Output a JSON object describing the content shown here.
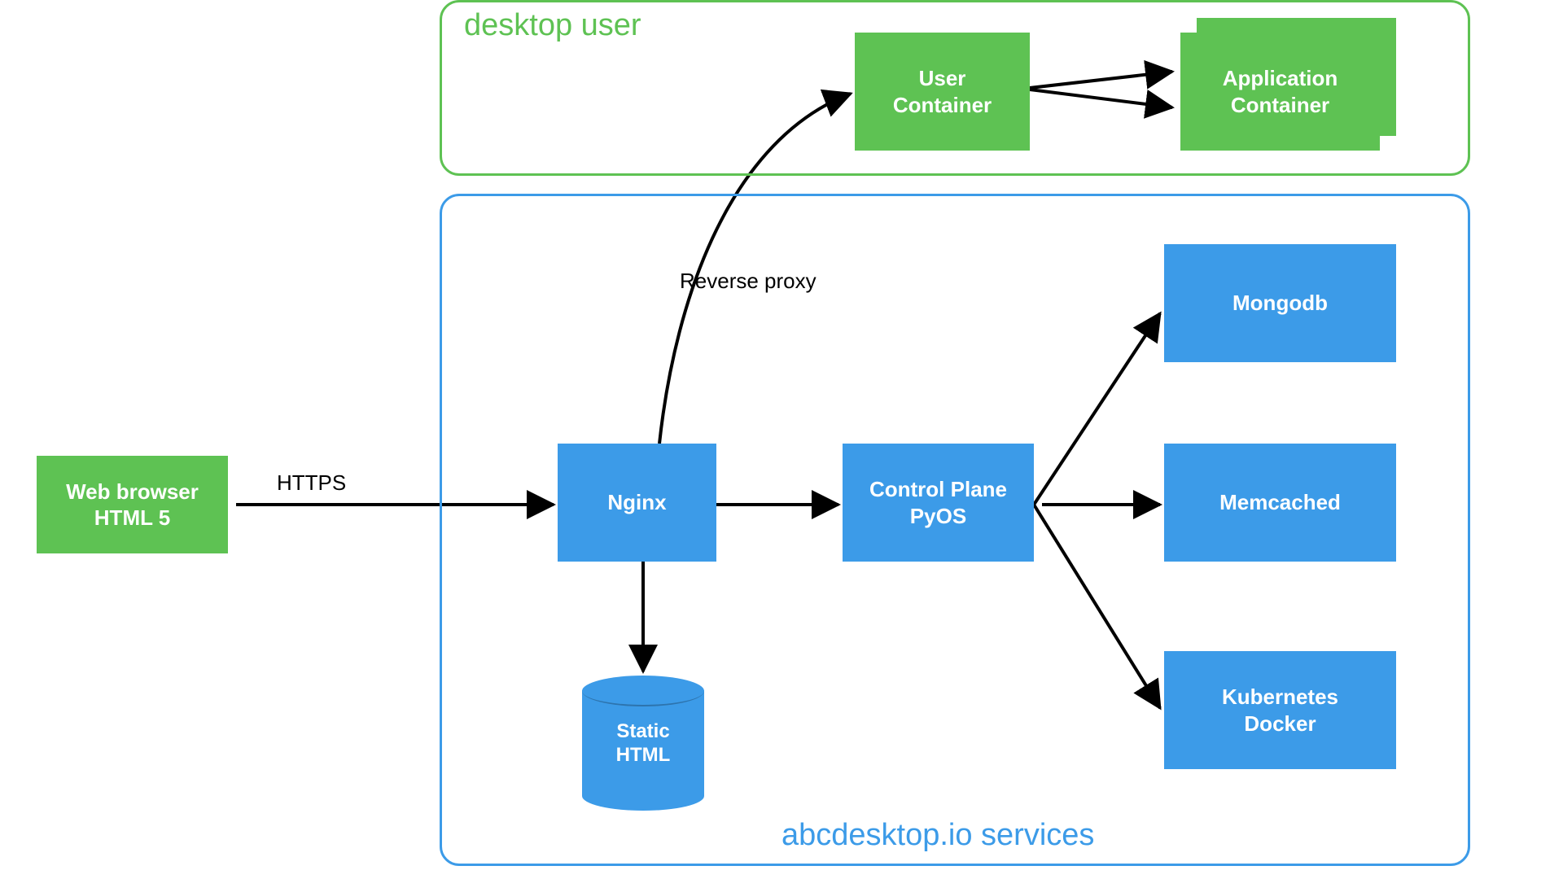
{
  "colors": {
    "green": "#5EC253",
    "blue": "#3C9BE8",
    "black": "#000000"
  },
  "groups": {
    "desktop_user": {
      "title": "desktop user"
    },
    "services": {
      "title": "abcdesktop.io services"
    }
  },
  "nodes": {
    "web_browser": "Web browser\nHTML 5",
    "user_container": "User\nContainer",
    "app_container": "Application\nContainer",
    "nginx": "Nginx",
    "control_plane": "Control Plane\nPyOS",
    "mongodb": "Mongodb",
    "memcached": "Memcached",
    "k8s_docker": "Kubernetes\nDocker",
    "static_html": "Static\nHTML"
  },
  "edge_labels": {
    "https": "HTTPS",
    "reverse_proxy": "Reverse proxy"
  },
  "edges": [
    {
      "from": "web_browser",
      "to": "nginx",
      "label": "https"
    },
    {
      "from": "nginx",
      "to": "user_container",
      "label": "reverse_proxy"
    },
    {
      "from": "nginx",
      "to": "control_plane"
    },
    {
      "from": "nginx",
      "to": "static_html"
    },
    {
      "from": "control_plane",
      "to": "mongodb"
    },
    {
      "from": "control_plane",
      "to": "memcached"
    },
    {
      "from": "control_plane",
      "to": "k8s_docker"
    },
    {
      "from": "user_container",
      "to": "app_container",
      "multi": true
    }
  ]
}
